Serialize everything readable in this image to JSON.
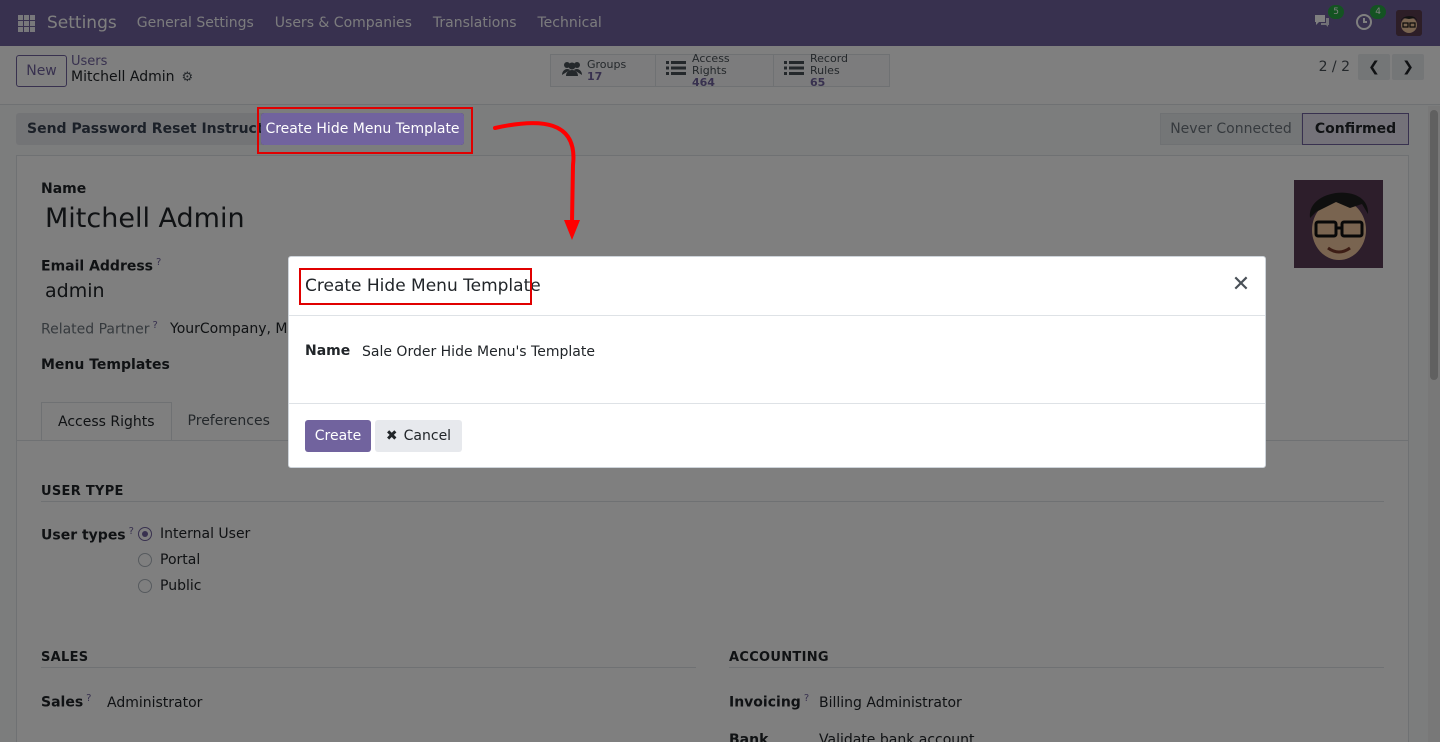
{
  "navbar": {
    "brand": "Settings",
    "menu": [
      "General Settings",
      "Users & Companies",
      "Translations",
      "Technical"
    ],
    "messages_badge": "5",
    "activity_badge": "4"
  },
  "control": {
    "new_label": "New",
    "breadcrumb_parent": "Users",
    "breadcrumb_current": "Mitchell Admin",
    "smart_buttons": [
      {
        "label": "Groups",
        "count": "17"
      },
      {
        "label": "Access Rights",
        "count": "464"
      },
      {
        "label": "Record Rules",
        "count": "65"
      }
    ],
    "pager": "2 / 2"
  },
  "statusbar": {
    "reset_label": "Send Password Reset Instructions",
    "hide_menu_label": "Create Hide Menu Template",
    "stages": [
      "Never Connected",
      "Confirmed"
    ]
  },
  "form": {
    "name_label": "Name",
    "name_value": "Mitchell Admin",
    "email_label": "Email Address",
    "email_value": "admin",
    "partner_label": "Related Partner",
    "partner_value": "YourCompany, Mitc",
    "menu_templates_label": "Menu Templates",
    "tabs": [
      "Access Rights",
      "Preferences"
    ],
    "user_type_title": "USER TYPE",
    "user_types_label": "User types",
    "user_types": [
      "Internal User",
      "Portal",
      "Public"
    ],
    "sales_title": "SALES",
    "sales_label": "Sales",
    "sales_value": "Administrator",
    "accounting_title": "ACCOUNTING",
    "invoicing_label": "Invoicing",
    "invoicing_value": "Billing Administrator",
    "bank_label": "Bank",
    "bank_value": "Validate bank account"
  },
  "modal": {
    "title": "Create Hide Menu Template",
    "name_label": "Name",
    "name_value": "Sale Order Hide Menu's Template",
    "create_label": "Create",
    "cancel_label": "Cancel"
  },
  "colors": {
    "primary": "#71639e",
    "highlight": "#e00000",
    "badge": "#28a745"
  }
}
